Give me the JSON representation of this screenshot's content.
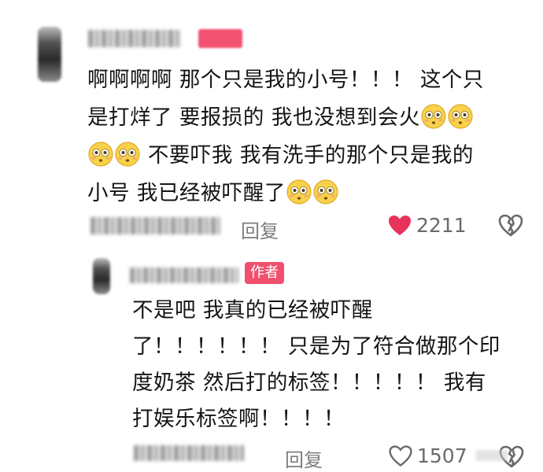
{
  "comment": {
    "text_line1": "啊啊啊啊 那个只是我的小号！！！ 这个只",
    "text_line2": "是打烊了 要报损的 我也没想到会火",
    "text_line3": " 不要吓我 我有洗手的那个只是我的",
    "text_line4": "小号 我已经被吓醒了",
    "reply_label": "回复",
    "like_count": "2211"
  },
  "reply": {
    "badge": "作者",
    "text_line1": "不是吧 我真的已经被吓醒",
    "text_line2": "了！！！！！！ 只是为了符合做那个印",
    "text_line3": "度奶茶 然后打的标签！！！！！ 我有",
    "text_line4": "打娱乐标签啊！！！！",
    "reply_label": "回复",
    "like_count": "1507"
  },
  "icons": {
    "like_filled": "heart-icon",
    "dislike": "broken-heart-icon",
    "emoji": "flushed-face-emoji"
  },
  "colors": {
    "like_red": "#e8325a",
    "badge_pink": "#f0506e",
    "text_dark": "#141414",
    "muted": "#7d7d7d"
  }
}
